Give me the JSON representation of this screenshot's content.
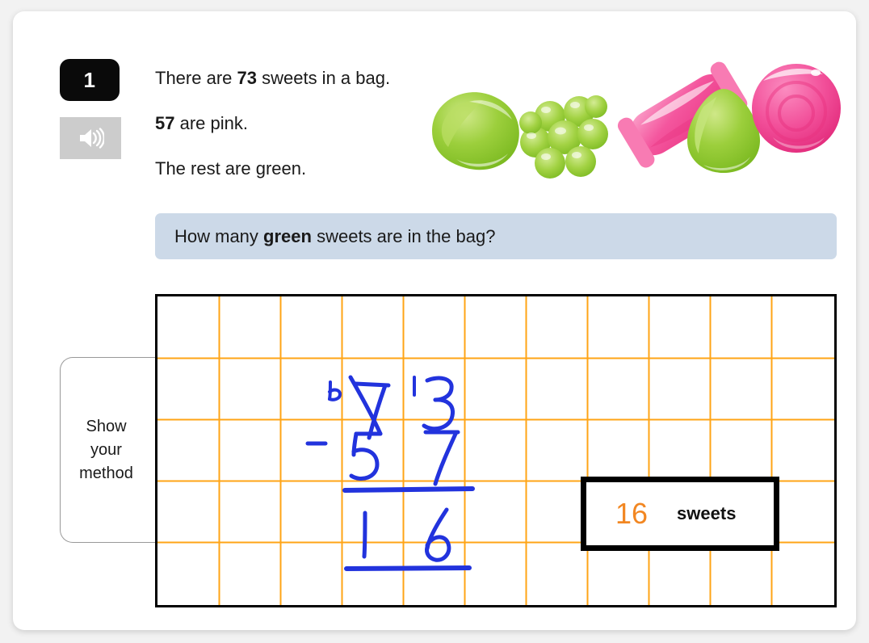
{
  "question": {
    "number": "1",
    "audio_icon": "speaker-icon",
    "statements": [
      {
        "prefix": "There are ",
        "bold": "73",
        "suffix": " sweets in a bag."
      },
      {
        "prefix": "",
        "bold": "57",
        "suffix": " are pink."
      },
      {
        "prefix": "The rest are green.",
        "bold": "",
        "suffix": ""
      }
    ],
    "prompt": {
      "prefix": "How many ",
      "bold": "green",
      "suffix": " sweets are in the bag?"
    }
  },
  "method": {
    "tab_label": "Show\nyour\nmethod",
    "tab_label_lines": [
      "Show",
      "your",
      "method"
    ],
    "grid": {
      "columns": 11,
      "rows": 5,
      "line_color": "#FFA416",
      "border_color": "#000000"
    },
    "handwriting": {
      "ink_color": "#2233DD",
      "borrow_tens": "6",
      "minuend_tens_crossed": "7",
      "borrow_ones": "1",
      "minuend_ones": "3",
      "operator": "-",
      "subtrahend_tens": "5",
      "subtrahend_ones": "7",
      "result_tens": "1",
      "result_ones": "6"
    }
  },
  "answer": {
    "value": "16",
    "unit": "sweets",
    "value_color": "#F28722"
  },
  "illustration": {
    "name": "sweets-illustration",
    "items": [
      {
        "name": "green-teardrop-sweet",
        "color": "#8DC63F"
      },
      {
        "name": "green-cluster-sweet",
        "color": "#8DC63F"
      },
      {
        "name": "pink-wrapped-sweet",
        "color": "#F0559B"
      },
      {
        "name": "green-drop-sweet",
        "color": "#8DC63F"
      },
      {
        "name": "pink-ring-sweet",
        "color": "#F0559B"
      }
    ]
  },
  "theme": {
    "card_bg": "#FFFFFF",
    "page_bg": "#F2F2F2",
    "prompt_bg": "#CCD9E8",
    "grid_line": "#FFA416",
    "ink": "#2233DD",
    "answer_orange": "#F28722"
  }
}
